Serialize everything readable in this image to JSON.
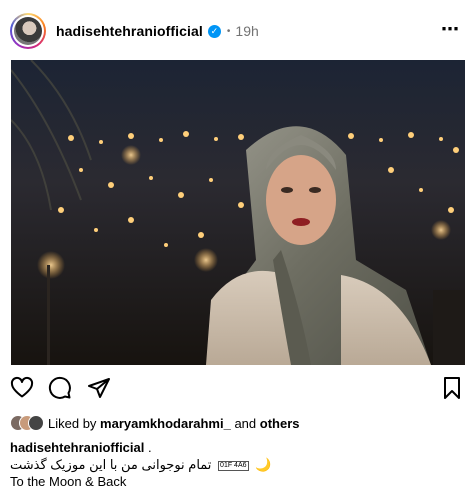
{
  "post": {
    "username": "hadisehtehraniofficial",
    "verified_mark": "✓",
    "separator": "•",
    "time": "19h",
    "more_label": "⋯",
    "icons": {
      "like": "heart-icon",
      "comment": "comment-icon",
      "share": "share-icon",
      "save": "bookmark-icon",
      "more": "more-options-icon"
    },
    "likes": {
      "prefix": "Liked by",
      "user": "maryamkhodarahmi_",
      "middle": "and",
      "others": "others"
    },
    "caption": {
      "user": "hadisehtehraniofficial",
      "user_suffix": ".",
      "persian_text": "تمام نوجوانی من با این موزیک گذشت",
      "emoji_moon": "🌙",
      "box_glyph": "01F 4A6",
      "english_text": "To the Moon & Back"
    }
  }
}
